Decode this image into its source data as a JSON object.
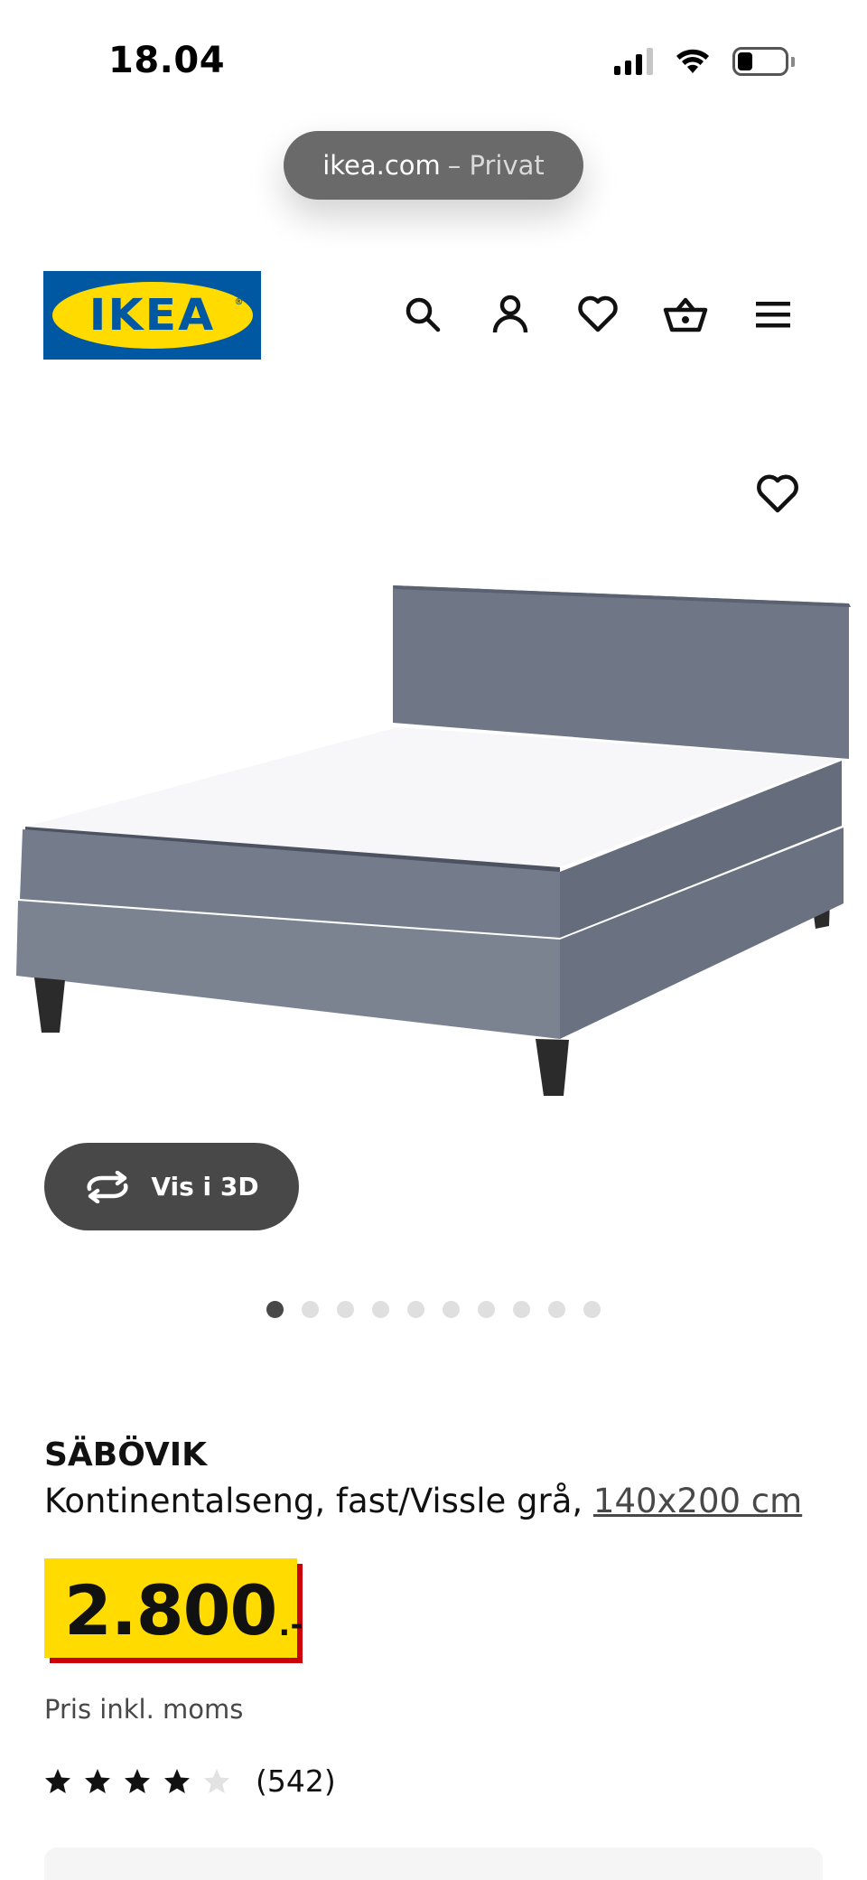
{
  "status_bar": {
    "time": "18.04"
  },
  "browser": {
    "url_domain": "ikea.com",
    "url_mode": "– Privat"
  },
  "header": {
    "logo_text": "IKEA",
    "logo_reg": "®",
    "icons": [
      "search-icon",
      "user-icon",
      "heart-icon",
      "basket-icon",
      "menu-icon"
    ]
  },
  "product_image": {
    "view_3d_label": "Vis i 3D",
    "carousel_total": 10,
    "carousel_active": 1
  },
  "product": {
    "name": "SÄBÖVIK",
    "description": "Kontinentalseng, fast/Vissle grå, ",
    "size": "140x200 cm",
    "price": "2.800",
    "price_suffix": ".-",
    "price_note": "Pris inkl. moms",
    "rating_stars": 4,
    "rating_max": 5,
    "rating_count": "(542)"
  },
  "colors": {
    "ikea_blue": "#0058a3",
    "ikea_yellow": "#ffdb00",
    "price_shadow": "#cc0008",
    "button_dark": "#484848"
  }
}
